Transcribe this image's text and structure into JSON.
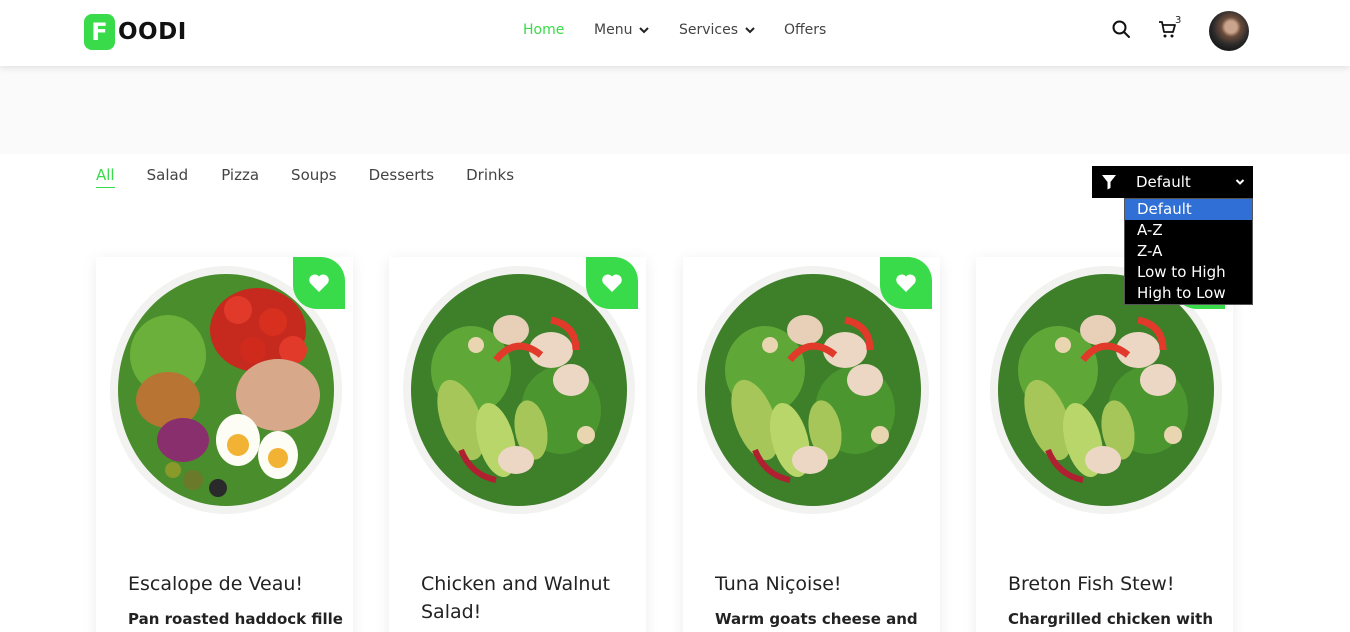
{
  "brand": {
    "badge": "F",
    "text": "OODI",
    "accent": "#39db4a"
  },
  "nav": {
    "items": [
      {
        "label": "Home",
        "active": true,
        "has_dropdown": false
      },
      {
        "label": "Menu",
        "active": false,
        "has_dropdown": true
      },
      {
        "label": "Services",
        "active": false,
        "has_dropdown": true
      },
      {
        "label": "Offers",
        "active": false,
        "has_dropdown": false
      }
    ]
  },
  "header": {
    "cart_count": "3",
    "icons": [
      "search-icon",
      "cart-icon",
      "avatar"
    ]
  },
  "categories": {
    "items": [
      "All",
      "Salad",
      "Pizza",
      "Soups",
      "Desserts",
      "Drinks"
    ],
    "active": "All"
  },
  "sort": {
    "selected": "Default",
    "options": [
      "Default",
      "A-Z",
      "Z-A",
      "Low to High",
      "High to Low"
    ]
  },
  "cards": [
    {
      "title": "Escalope de Veau!",
      "desc": "Pan roasted haddock fillet",
      "image": "nicoise-salad-plate"
    },
    {
      "title": "Chicken and Walnut Salad!",
      "desc": "",
      "image": "chicken-avocado-salad-plate"
    },
    {
      "title": "Tuna Niçoise!",
      "desc": "Warm goats cheese and",
      "image": "chicken-avocado-salad-plate"
    },
    {
      "title": "Breton Fish Stew!",
      "desc": "Chargrilled chicken with",
      "image": "chicken-avocado-salad-plate"
    }
  ]
}
